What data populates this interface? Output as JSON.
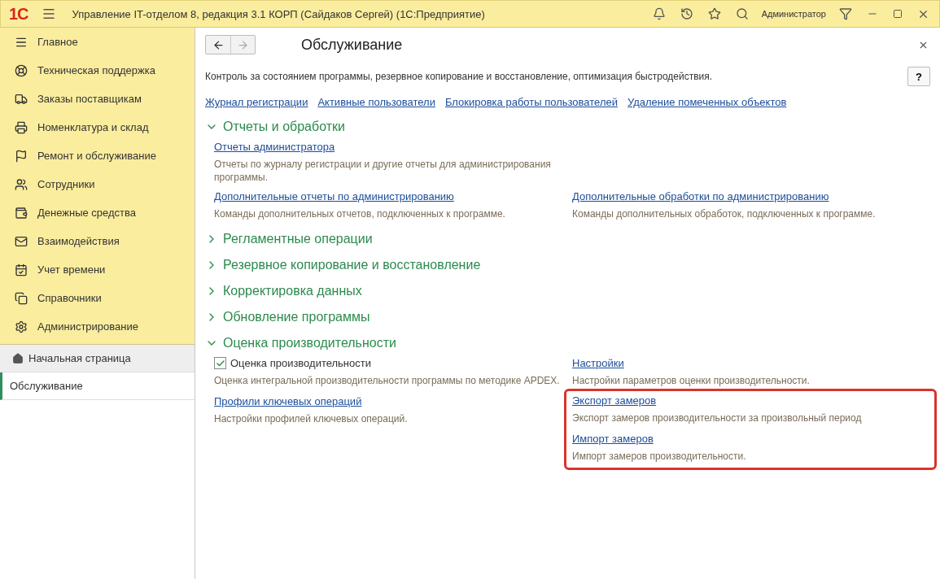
{
  "window": {
    "logo": "1С",
    "title": "Управление IT-отделом 8, редакция 3.1 КОРП (Сайдаков Сергей)  (1С:Предприятие)",
    "user": "Администратор"
  },
  "sections": [
    {
      "label": "Главное"
    },
    {
      "label": "Техническая поддержка"
    },
    {
      "label": "Заказы поставщикам"
    },
    {
      "label": "Номенклатура и склад"
    },
    {
      "label": "Ремонт и обслуживание"
    },
    {
      "label": "Сотрудники"
    },
    {
      "label": "Денежные средства"
    },
    {
      "label": "Взаимодействия"
    },
    {
      "label": "Учет времени"
    },
    {
      "label": "Справочники"
    },
    {
      "label": "Администрирование"
    }
  ],
  "open_windows": [
    {
      "label": "Начальная страница",
      "kind": "home",
      "selected": false
    },
    {
      "label": "Обслуживание",
      "kind": "page",
      "selected": true
    }
  ],
  "page": {
    "title": "Обслуживание",
    "description": "Контроль за состоянием программы, резервное копирование и восстановление, оптимизация быстродействия.",
    "help": "?",
    "links": [
      "Журнал регистрации",
      "Активные пользователи",
      "Блокировка работы пользователей",
      "Удаление помеченных объектов"
    ],
    "groups": [
      {
        "title": "Отчеты и обработки",
        "expanded": true,
        "rows": [
          {
            "left": [
              {
                "kind": "link",
                "label": "Отчеты администратора",
                "description": "Отчеты по журналу регистрации и другие отчеты для администрирования программы."
              }
            ]
          },
          {
            "left": [
              {
                "kind": "link",
                "label": "Дополнительные отчеты по администрированию",
                "description": "Команды дополнительных отчетов, подключенных к программе."
              }
            ],
            "right": [
              {
                "kind": "link",
                "label": "Дополнительные обработки по администрированию",
                "description": "Команды дополнительных обработок, подключенных к программе."
              }
            ]
          }
        ]
      },
      {
        "title": "Регламентные операции",
        "expanded": false
      },
      {
        "title": "Резервное копирование и восстановление",
        "expanded": false
      },
      {
        "title": "Корректировка данных",
        "expanded": false
      },
      {
        "title": "Обновление программы",
        "expanded": false
      },
      {
        "title": "Оценка производительности",
        "expanded": true,
        "rows": [
          {
            "left": [
              {
                "kind": "checkbox",
                "label": "Оценка производительности",
                "checked": true,
                "description": "Оценка интегральной производительности программы по методике APDEX."
              },
              {
                "kind": "link",
                "label": "Профили ключевых операций",
                "description": "Настройки профилей ключевых операций."
              }
            ],
            "right": [
              {
                "kind": "link",
                "label": "Настройки",
                "description": "Настройки параметров оценки производительности."
              }
            ],
            "right_framed": [
              {
                "kind": "link",
                "label": "Экспорт замеров",
                "description": "Экспорт замеров производительности за произвольный период"
              },
              {
                "kind": "link",
                "label": "Импорт замеров",
                "description": "Импорт замеров производительности."
              }
            ]
          }
        ]
      }
    ]
  }
}
